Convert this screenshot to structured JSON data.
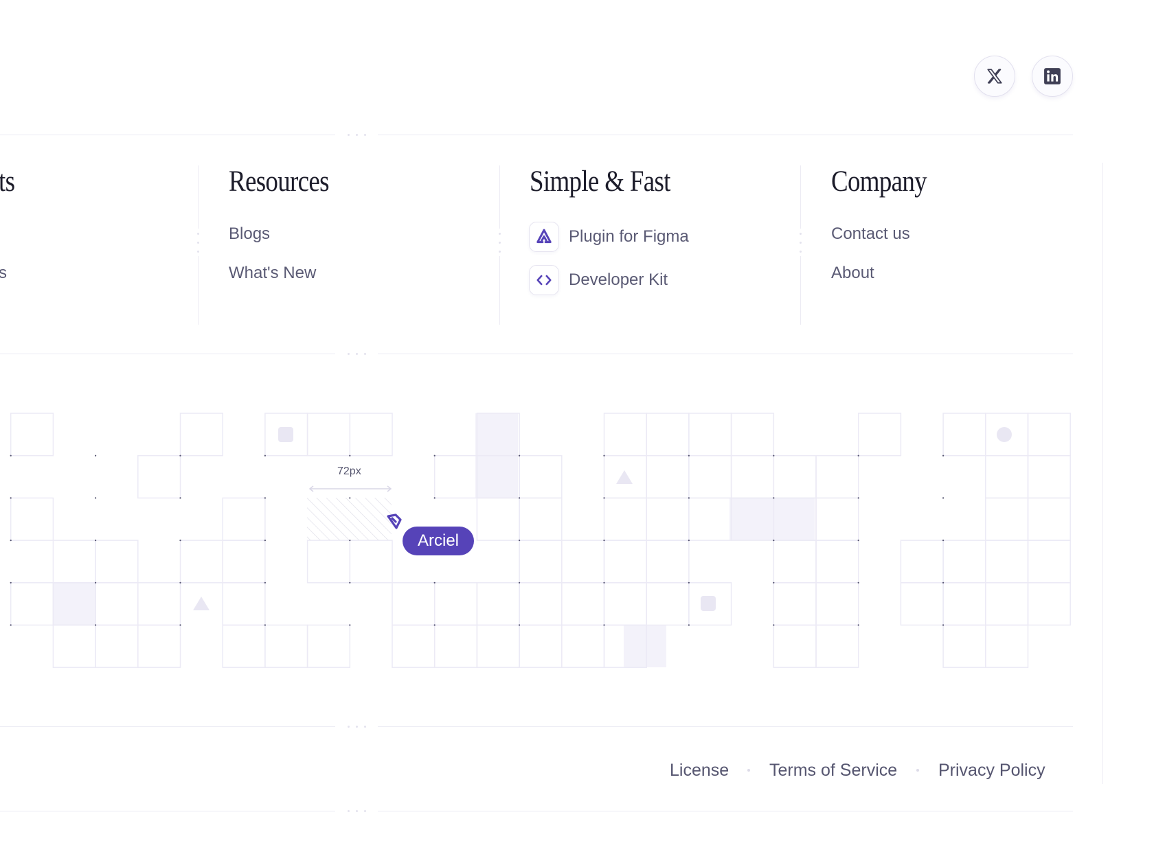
{
  "social": [
    {
      "name": "x-icon",
      "label": "X"
    },
    {
      "name": "linkedin-icon",
      "label": "LinkedIn"
    }
  ],
  "columns": {
    "partial_title": "ts",
    "partial_item": "s",
    "resources": {
      "title": "Resources",
      "items": [
        "Blogs",
        "What's New"
      ]
    },
    "simple_fast": {
      "title": "Simple & Fast",
      "items": [
        {
          "label": "Plugin for Figma",
          "icon": "figma-plugin-icon"
        },
        {
          "label": "Developer Kit",
          "icon": "code-brackets-icon"
        }
      ]
    },
    "company": {
      "title": "Company",
      "items": [
        "Contact us",
        "About"
      ]
    }
  },
  "grid_demo": {
    "measure_label": "72px",
    "cursor_name": "Arciel",
    "accent_color": "#5643b8"
  },
  "footer": {
    "links": [
      "License",
      "Terms of Service",
      "Privacy Policy"
    ]
  }
}
